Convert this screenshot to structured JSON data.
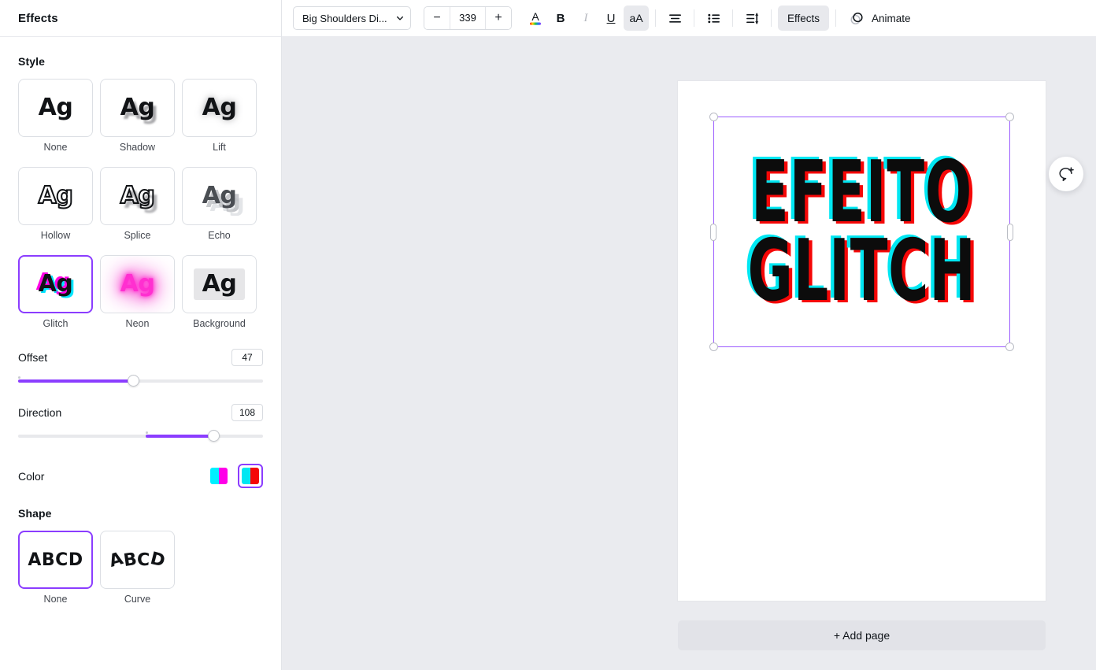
{
  "sidebar": {
    "title": "Effects",
    "style_section_label": "Style",
    "shape_section_label": "Shape",
    "styles": [
      {
        "label": "None",
        "selected": false
      },
      {
        "label": "Shadow",
        "selected": false
      },
      {
        "label": "Lift",
        "selected": false
      },
      {
        "label": "Hollow",
        "selected": false
      },
      {
        "label": "Splice",
        "selected": false
      },
      {
        "label": "Echo",
        "selected": false
      },
      {
        "label": "Glitch",
        "selected": true
      },
      {
        "label": "Neon",
        "selected": false
      },
      {
        "label": "Background",
        "selected": false
      }
    ],
    "style_sample_text": "Ag",
    "sliders": [
      {
        "name": "Offset",
        "value": "47",
        "percent": 47,
        "origin": 0
      },
      {
        "name": "Direction",
        "value": "108",
        "percent": 80,
        "origin": 52
      }
    ],
    "color": {
      "label": "Color",
      "swatches": [
        {
          "name": "cyan-magenta",
          "left": "#00f0ff",
          "right": "#ff00e8",
          "selected": false
        },
        {
          "name": "cyan-red",
          "left": "#00e7f2",
          "right": "#f50707",
          "selected": true
        }
      ]
    },
    "shapes": [
      {
        "label": "None",
        "sample": "ABCD",
        "selected": true
      },
      {
        "label": "Curve",
        "sample": "ABCD",
        "selected": false
      }
    ]
  },
  "toolbar": {
    "font_name": "Big Shoulders Di...",
    "font_size": "339",
    "decrease_label": "−",
    "increase_label": "+",
    "text_color_icon": "text-color-icon",
    "bold_label": "B",
    "italic_label": "I",
    "underline_label": "U",
    "case_label": "aA",
    "align_icon": "align-left-icon",
    "list_icon": "bullet-list-icon",
    "spacing_icon": "line-spacing-icon",
    "effects_label": "Effects",
    "animate_label": "Animate"
  },
  "canvas": {
    "page_tools": [
      {
        "name": "unlock-icon"
      },
      {
        "name": "duplicate-page-icon"
      },
      {
        "name": "add-page-icon"
      }
    ],
    "text_line_1": "EFEITO",
    "text_line_2": "GLITCH",
    "text_color": "#0c0c0c",
    "glitch_cyan": "#00e7f2",
    "glitch_red": "#f50707",
    "selection_color": "#9b5cff",
    "refresh_icon": "refresh-icon",
    "add_page_label": "+ Add page",
    "comment_fab_icon": "add-comment-icon"
  },
  "theme": {
    "accent": "#8b3dff",
    "canvas_bg": "#eaebef",
    "panel_bg": "#ffffff"
  }
}
